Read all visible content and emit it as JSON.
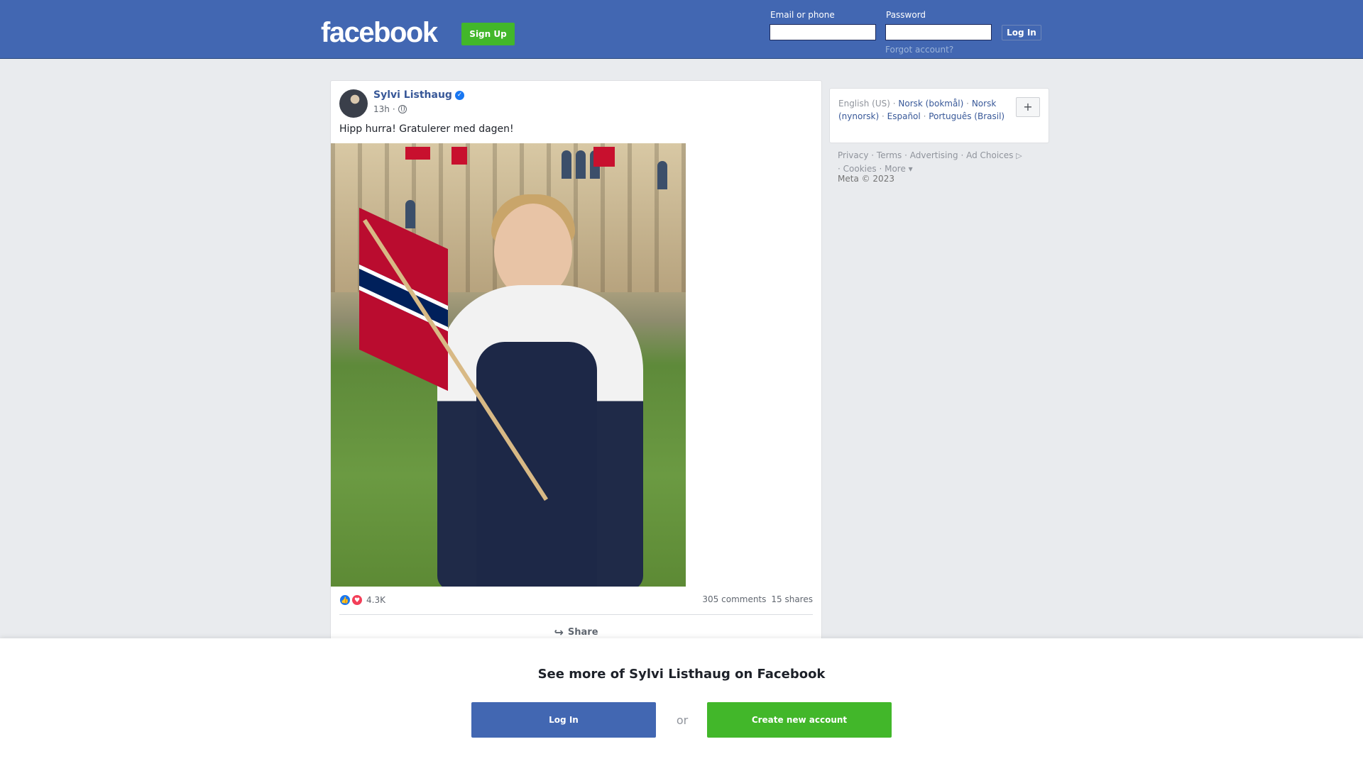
{
  "header": {
    "logo": "facebook",
    "signup_label": "Sign Up",
    "email_label": "Email or phone",
    "email_value": "",
    "password_label": "Password",
    "password_value": "",
    "login_label": "Log In",
    "forgot_label": "Forgot account?"
  },
  "post": {
    "author": "Sylvi Listhaug",
    "verified_icon": "verified-badge-icon",
    "time": "13h",
    "privacy_icon": "globe-icon",
    "text": "Hipp hurra! Gratulerer med dagen!",
    "reaction_count": "4.3K",
    "comments": "305 comments",
    "shares": "15 shares",
    "share_label": "Share"
  },
  "languages": {
    "current": "English (US)",
    "options": [
      "Norsk (bokmål)",
      "Norsk (nynorsk)",
      "Español",
      "Português (Brasil)"
    ],
    "more_label": "+"
  },
  "footer": {
    "links": [
      "Privacy",
      "Terms",
      "Advertising",
      "Ad Choices",
      "Cookies",
      "More"
    ],
    "copyright": "Meta © 2023"
  },
  "overlay": {
    "title": "See more of Sylvi Listhaug on Facebook",
    "login_label": "Log In",
    "or_label": "or",
    "create_label": "Create new account"
  },
  "colors": {
    "brand_blue": "#4267b2",
    "green": "#42b72a",
    "link": "#385898"
  }
}
